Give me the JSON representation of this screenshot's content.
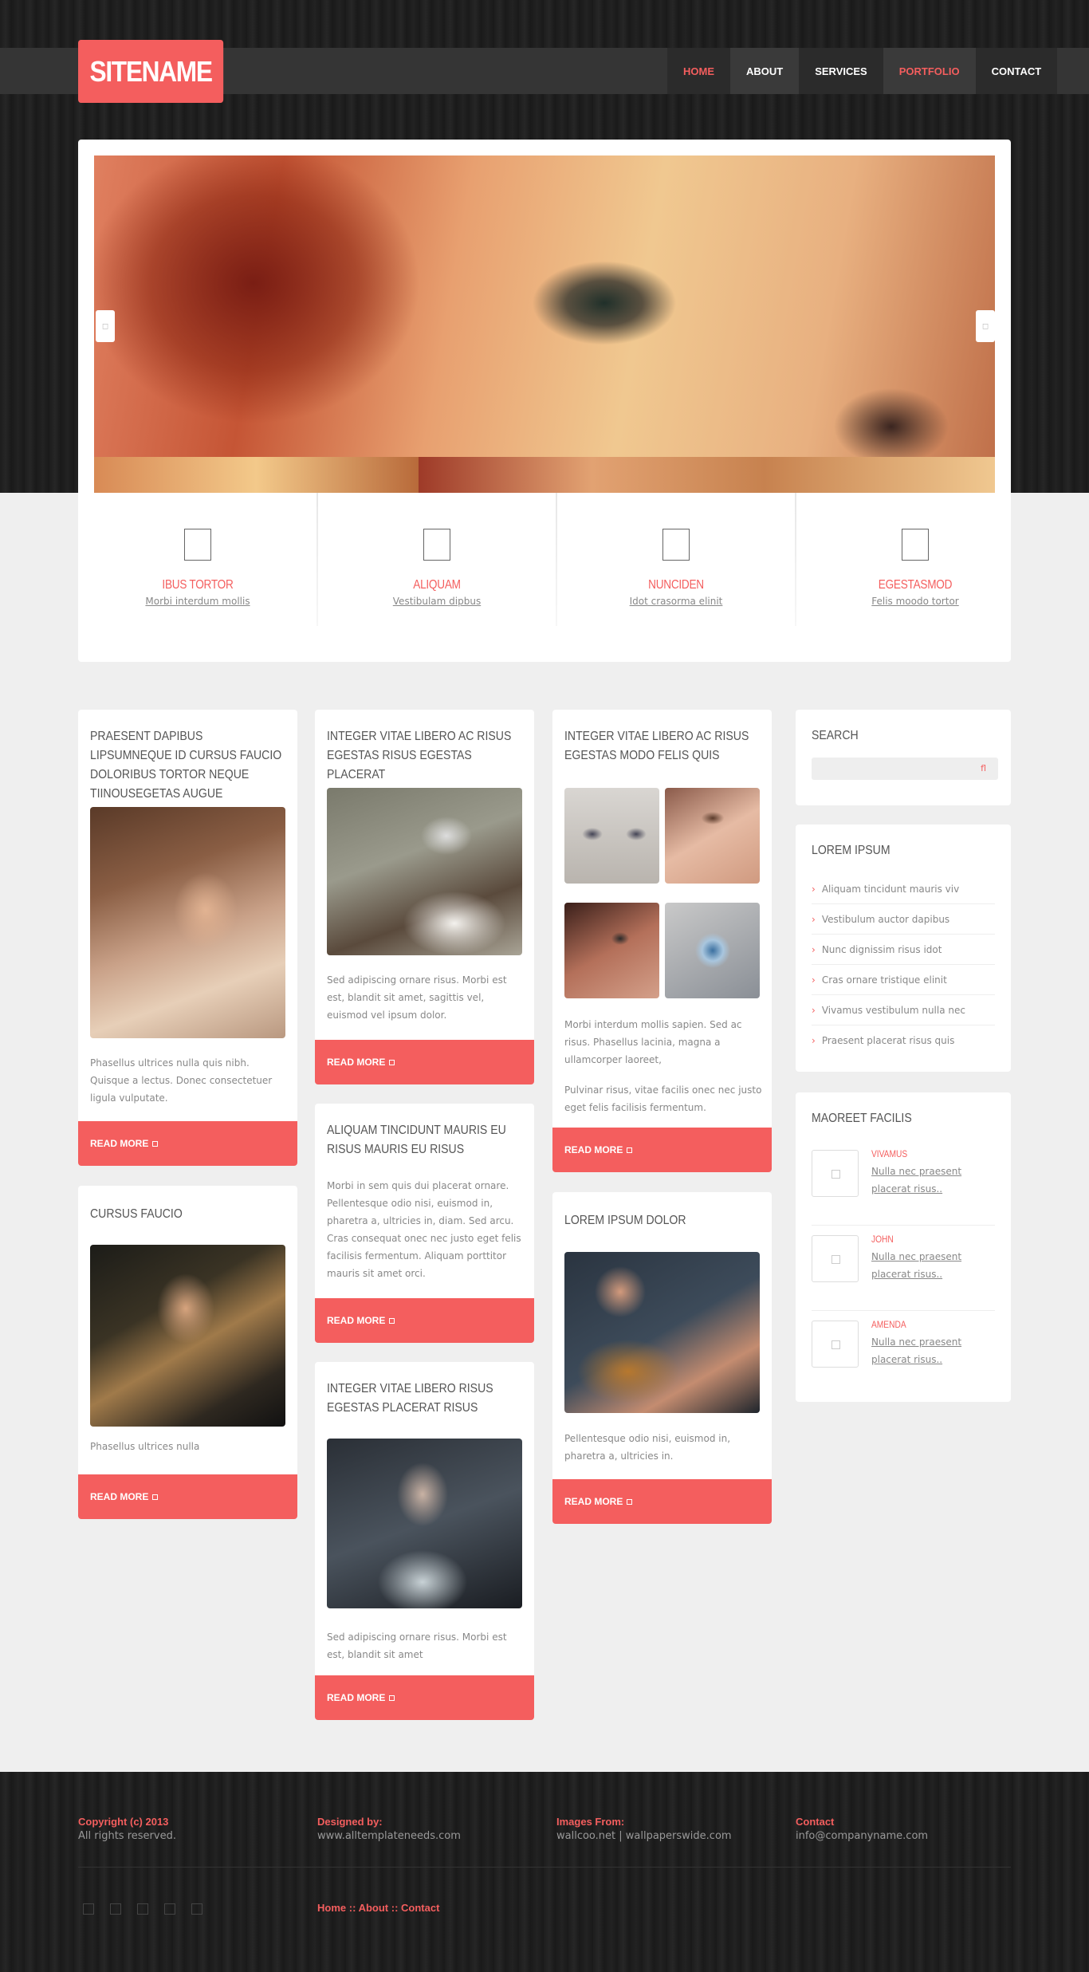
{
  "site": {
    "logo": "SITENAME"
  },
  "nav": [
    {
      "label": "HOME"
    },
    {
      "label": "ABOUT"
    },
    {
      "label": "SERVICES"
    },
    {
      "label": "PORTFOLIO"
    },
    {
      "label": "CONTACT"
    }
  ],
  "slider": {
    "prev": "◻",
    "next": "◻"
  },
  "features": [
    {
      "title": "IBUS TORTOR",
      "link": "Morbi interdum mollis"
    },
    {
      "title": "ALIQUAM",
      "link": "Vestibulam dipbus"
    },
    {
      "title": "NUNCIDEN",
      "link": "Idot crasorma elinit"
    },
    {
      "title": "EGESTASMOD",
      "link": "Felis moodo tortor"
    }
  ],
  "readmore": "READ MORE",
  "col1": {
    "card1": {
      "title": "PRAESENT DAPIBUS LIPSUMNEQUE ID CURSUS FAUCIO DOLORIBUS TORTOR NEQUE TIINOUSEGETAS AUGUE",
      "text": "Phasellus ultrices nulla quis nibh. Quisque a lectus. Donec consectetuer ligula vulputate."
    },
    "card2": {
      "title": "CURSUS FAUCIO",
      "text": "Phasellus ultrices nulla"
    }
  },
  "col2": {
    "card1": {
      "title": "INTEGER VITAE LIBERO AC RISUS EGESTAS RISUS EGESTAS PLACERAT",
      "text": "Sed adipiscing ornare risus. Morbi est est, blandit sit amet, sagittis vel, euismod vel ipsum dolor."
    },
    "card2": {
      "title": "ALIQUAM TINCIDUNT MAURIS EU RISUS MAURIS EU RISUS",
      "text": "Morbi in sem quis dui placerat ornare. Pellentesque odio nisi, euismod in, pharetra a, ultricies in, diam. Sed arcu. Cras consequat onec nec justo eget felis facilisis fermentum. Aliquam porttitor mauris sit amet orci."
    },
    "card3": {
      "title": "INTEGER VITAE LIBERO RISUS EGESTAS PLACERAT RISUS",
      "text": "Sed adipiscing ornare risus. Morbi est est, blandit sit amet"
    }
  },
  "col3": {
    "card1": {
      "title": "INTEGER VITAE LIBERO AC RISUS EGESTAS MODO FELIS QUIS",
      "text": "Morbi interdum mollis sapien. Sed ac risus. Phasellus lacinia, magna a ullamcorper laoreet,",
      "text2": "Pulvinar risus, vitae facilis onec nec justo eget felis facilisis fermentum."
    },
    "card2": {
      "title": "LOREM IPSUM DOLOR",
      "text": "Pellentesque odio nisi, euismod in, pharetra a, ultricies in."
    }
  },
  "sidebar": {
    "search": {
      "title": "SEARCH",
      "icon": "fl"
    },
    "lorem": {
      "title": "LOREM IPSUM",
      "items": [
        "Aliquam tincidunt mauris viv",
        "Vestibulum auctor dapibus",
        "Nunc dignissim risus idot",
        "Cras ornare tristique elinit",
        "Vivamus vestibulum nulla nec",
        "Praesent placerat risus quis"
      ]
    },
    "maoreet": {
      "title": "MAOREET FACILIS",
      "people": [
        {
          "name": "VIVAMUS",
          "text": "Nulla nec praesent placerat risus.."
        },
        {
          "name": "JOHN",
          "text": "Nulla nec praesent placerat risus.."
        },
        {
          "name": "AMENDA",
          "text": "Nulla nec praesent placerat risus.."
        }
      ]
    }
  },
  "footer": {
    "col1": {
      "head": "Copyright (c) 2013",
      "text": "All rights reserved."
    },
    "col2": {
      "head": "Designed by:",
      "text": "www.alltemplateneeds.com"
    },
    "col3": {
      "head": "Images From:",
      "text": "wallcoo.net | wallpaperswide.com"
    },
    "col4": {
      "head": "Contact",
      "text": "info@companyname.com"
    },
    "links": {
      "home": "Home",
      "about": "About",
      "contact": "Contact",
      "sep": "::"
    }
  },
  "colors": {
    "accent": "#f45e5e",
    "dark": "#222222",
    "nav": "#353535",
    "page": "#efefef"
  }
}
